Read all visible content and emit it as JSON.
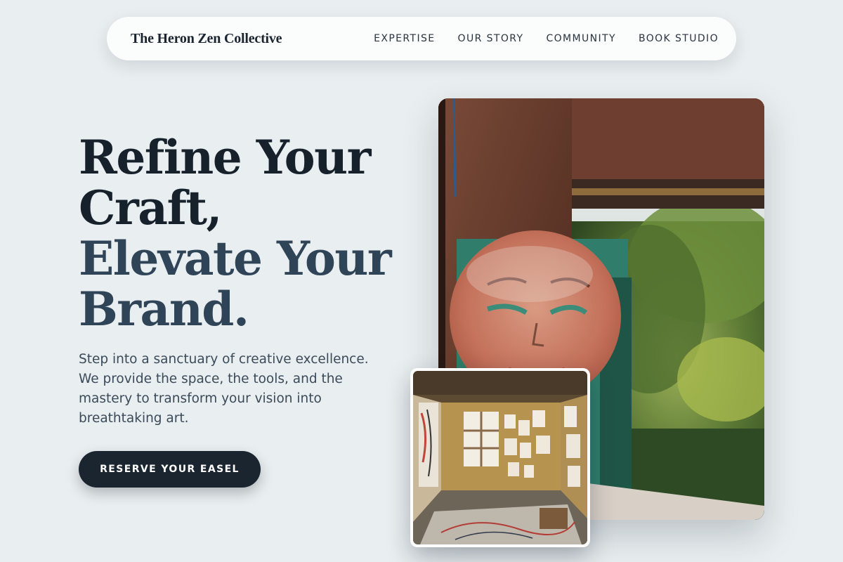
{
  "nav": {
    "brand": "The Heron Zen Collective",
    "links": [
      {
        "label": "EXPERTISE"
      },
      {
        "label": "OUR STORY"
      },
      {
        "label": "COMMUNITY"
      },
      {
        "label": "BOOK STUDIO"
      }
    ]
  },
  "hero": {
    "headline_line1": "Refine Your",
    "headline_line2": "Craft,",
    "headline_line3": "Elevate Your",
    "headline_line4": "Brand.",
    "description": "Step into a sanctuary of creative excellence. We provide the space, the tools, and the mastery to transform your vision into breathtaking art.",
    "cta_label": "RESERVE YOUR EASEL"
  },
  "colors": {
    "background": "#e9eef0",
    "primary_dark": "#1b2530",
    "accent_slate": "#304458"
  }
}
